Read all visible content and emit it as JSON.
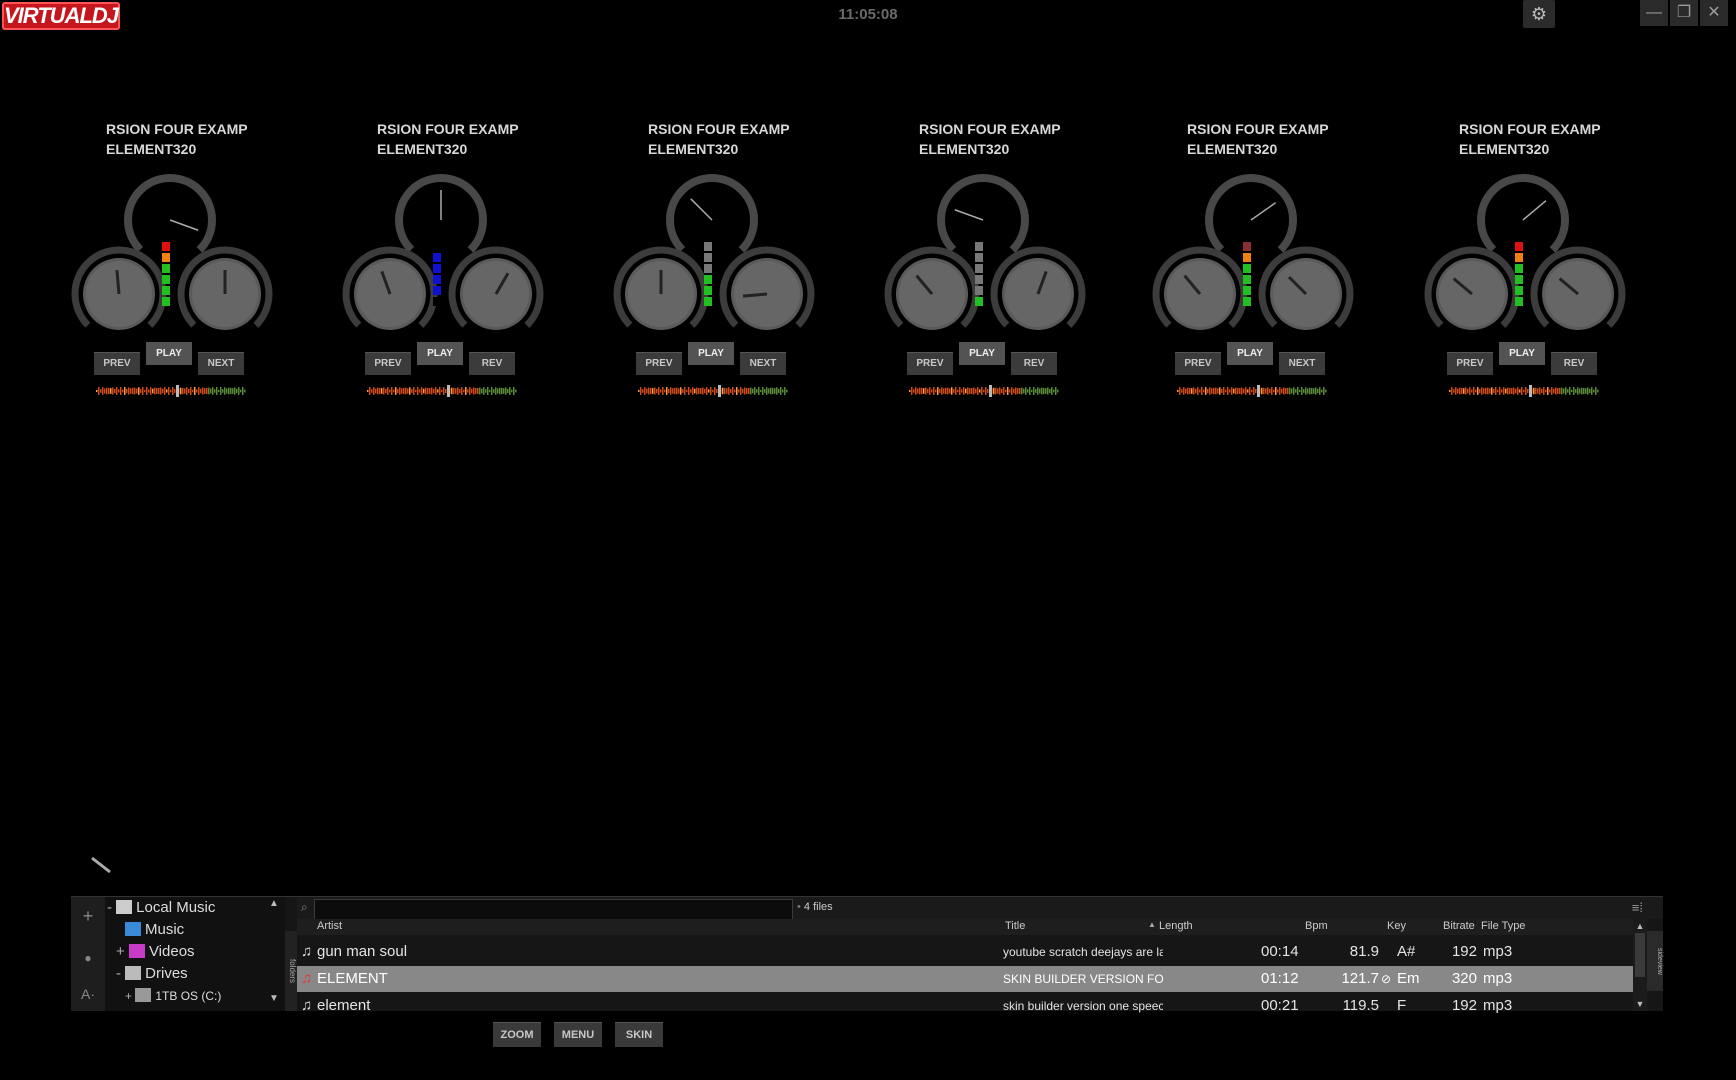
{
  "app": {
    "logo": "VIRTUALDJ",
    "clock": "11:05:08"
  },
  "window": {
    "minimize": "—",
    "restore": "❐",
    "close": "✕",
    "settings": "⚙"
  },
  "decks": [
    {
      "line1": "RSION FOUR EXAMP",
      "line2": "ELEMENT320",
      "prev": "PREV",
      "play": "PLAY",
      "next": "NEXT",
      "vu": [
        "#e01010",
        "#f08010",
        "#20c020",
        "#20c020",
        "#20c020",
        "#20c020"
      ]
    },
    {
      "line1": "RSION FOUR EXAMP",
      "line2": "ELEMENT320",
      "prev": "PREV",
      "play": "PLAY",
      "next": "REV",
      "vu": [
        "#000",
        "#1010d0",
        "#1010d0",
        "#1010d0",
        "#1010d0",
        "#000"
      ]
    },
    {
      "line1": "RSION FOUR EXAMP",
      "line2": "ELEMENT320",
      "prev": "PREV",
      "play": "PLAY",
      "next": "NEXT",
      "vu": [
        "#777",
        "#777",
        "#777",
        "#20c020",
        "#20c020",
        "#20c020"
      ]
    },
    {
      "line1": "RSION FOUR EXAMP",
      "line2": "ELEMENT320",
      "prev": "PREV",
      "play": "PLAY",
      "next": "REV",
      "vu": [
        "#777",
        "#777",
        "#777",
        "#777",
        "#777",
        "#20c020"
      ]
    },
    {
      "line1": "RSION FOUR EXAMP",
      "line2": "ELEMENT320",
      "prev": "PREV",
      "play": "PLAY",
      "next": "NEXT",
      "vu": [
        "#8a3030",
        "#f08010",
        "#20c020",
        "#20c020",
        "#20c020",
        "#20c020"
      ]
    },
    {
      "line1": "RSION FOUR EXAMP",
      "line2": "ELEMENT320",
      "prev": "PREV",
      "play": "PLAY",
      "next": "REV",
      "vu": [
        "#e01010",
        "#f08010",
        "#20c020",
        "#20c020",
        "#20c020",
        "#20c020"
      ]
    }
  ],
  "browser": {
    "rail": {
      "add": "+",
      "record": "●",
      "font": "A·"
    },
    "tree": {
      "local_music": "Local Music",
      "music": "Music",
      "videos": "Videos",
      "drives": "Drives",
      "drive_c": "1TB OS (C:)",
      "folders_tab": "folders"
    },
    "file_count": "4 files",
    "search_placeholder": "",
    "columns": {
      "artist": "Artist",
      "title": "Title",
      "length": "Length",
      "bpm": "Bpm",
      "key": "Key",
      "bitrate": "Bitrate",
      "filetype": "File Type"
    },
    "rows": [
      {
        "artist": "gun man soul",
        "title": "youtube scratch deejays are laz...",
        "length": "00:14",
        "bpm": "81.9",
        "key": "A#",
        "bitrate": "192",
        "filetype": "mp3"
      },
      {
        "artist": "ELEMENT",
        "title": "SKIN BUILDER VERSION FOUR E",
        "length": "01:12",
        "bpm": "121.7",
        "key": "Em",
        "bitrate": "320",
        "filetype": "mp3"
      },
      {
        "artist": "element",
        "title": "skin builder version one speech...",
        "length": "00:21",
        "bpm": "119.5",
        "key": "F",
        "bitrate": "192",
        "filetype": "mp3"
      }
    ],
    "side_tab": "sideview"
  },
  "bottom": {
    "zoom": "ZOOM",
    "menu": "MENU",
    "skin": "SKIN"
  }
}
